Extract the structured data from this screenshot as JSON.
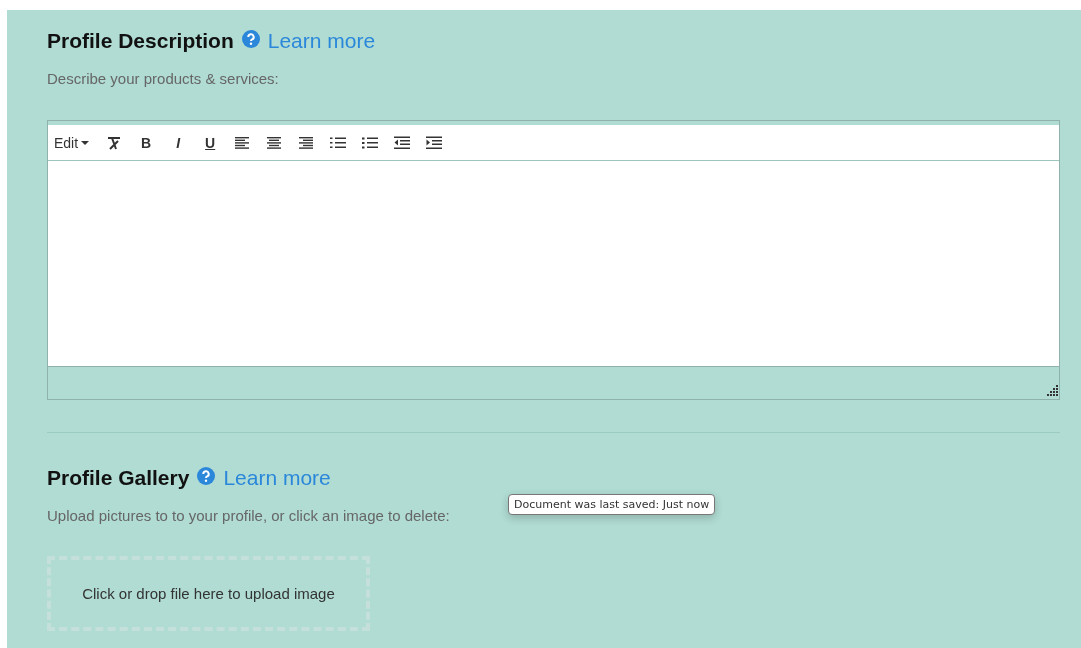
{
  "sections": [
    {
      "kind": "editor",
      "title": "Profile Description",
      "link": "Learn more",
      "description": "Describe your products & services:",
      "toolbar": [
        {
          "kind": "menu",
          "label": "Edit"
        },
        {
          "kind": "clear-format"
        },
        {
          "kind": "bold",
          "label": "B"
        },
        {
          "kind": "italic",
          "label": "I"
        },
        {
          "kind": "underline",
          "label": "U"
        },
        {
          "kind": "align-left"
        },
        {
          "kind": "align-center"
        },
        {
          "kind": "align-right"
        },
        {
          "kind": "bullet-list"
        },
        {
          "kind": "numbered-list"
        },
        {
          "kind": "outdent"
        },
        {
          "kind": "indent"
        }
      ]
    },
    {
      "kind": "gallery",
      "title": "Profile Gallery",
      "link": "Learn more",
      "description": "Upload pictures to to your profile, or click an image to delete:",
      "dropzone": "Click or drop file here to upload image"
    }
  ],
  "tooltip": "Document was last saved: Just now"
}
